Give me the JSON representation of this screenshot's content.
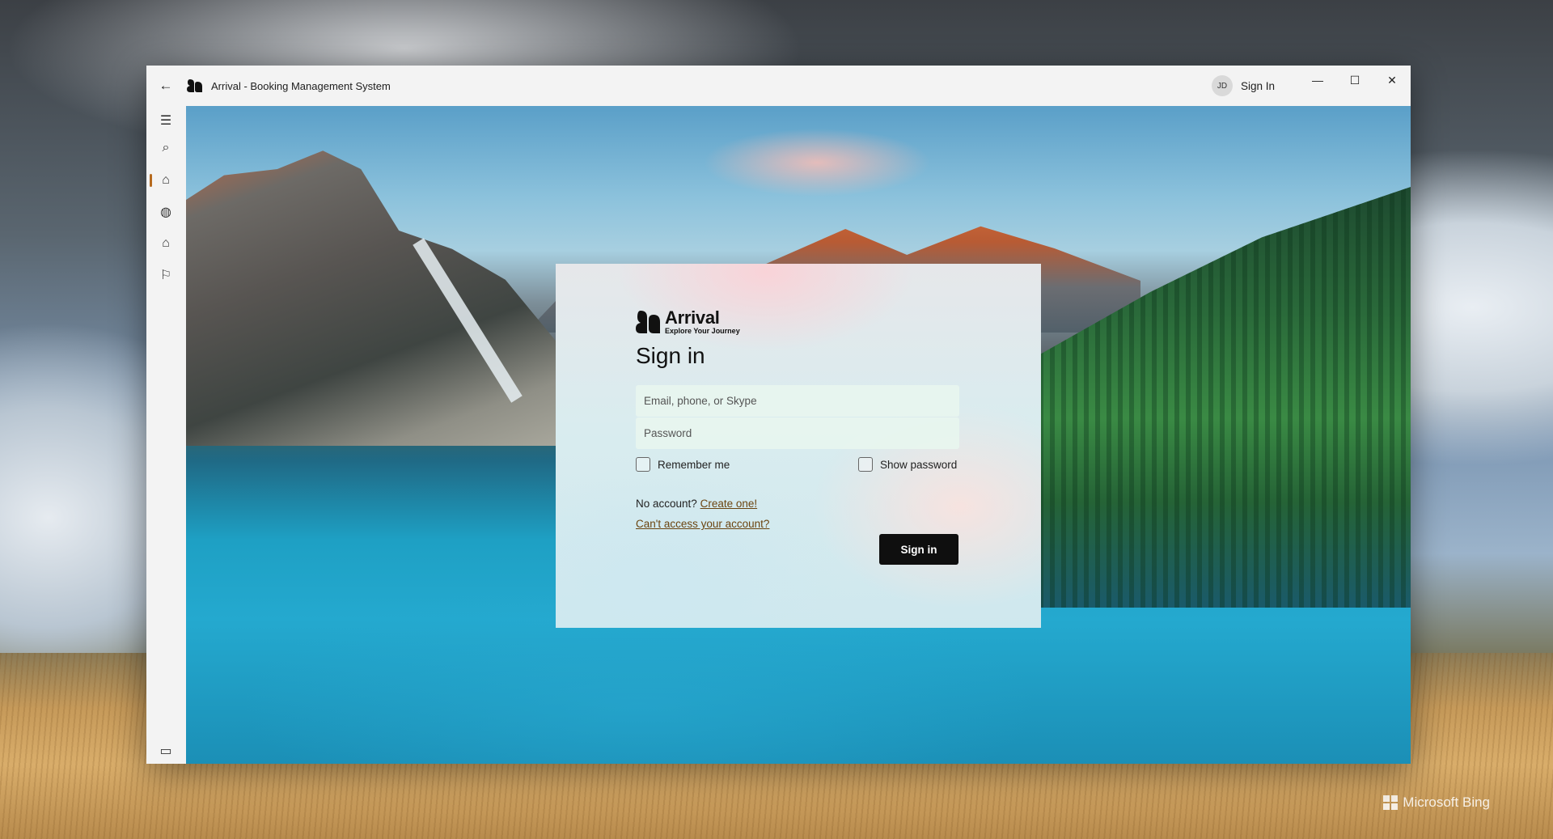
{
  "window": {
    "title": "Arrival - Booking Management System",
    "user_initials": "JD",
    "signin_label": "Sign In"
  },
  "sidebar": {
    "items": [
      {
        "name": "menu-icon",
        "glyph": "☰"
      },
      {
        "name": "search-icon",
        "glyph": "⌕"
      },
      {
        "name": "home-icon",
        "glyph": "⌂",
        "selected": true
      },
      {
        "name": "globe-icon",
        "glyph": "◍"
      },
      {
        "name": "hotel-icon",
        "glyph": "⌂"
      },
      {
        "name": "flag-icon",
        "glyph": "⚐"
      }
    ],
    "bottom_items": [
      {
        "name": "feedback-icon",
        "glyph": "▭"
      },
      {
        "name": "settings-icon",
        "glyph": "⚙"
      }
    ]
  },
  "login": {
    "brand_name": "Arrival",
    "brand_tagline": "Explore Your Journey",
    "title": "Sign in",
    "email_placeholder": "Email, phone, or Skype",
    "password_placeholder": "Password",
    "remember_label": "Remember me",
    "show_password_label": "Show password",
    "no_account_text": "No account?",
    "create_link": "Create one!",
    "cant_access_link": "Can't access your account?",
    "submit_label": "Sign in"
  },
  "wallpaper": {
    "credit": "Microsoft Bing"
  },
  "colors": {
    "accent": "#b66a1e",
    "link": "#6b4410",
    "button": "#0f0f0f"
  }
}
